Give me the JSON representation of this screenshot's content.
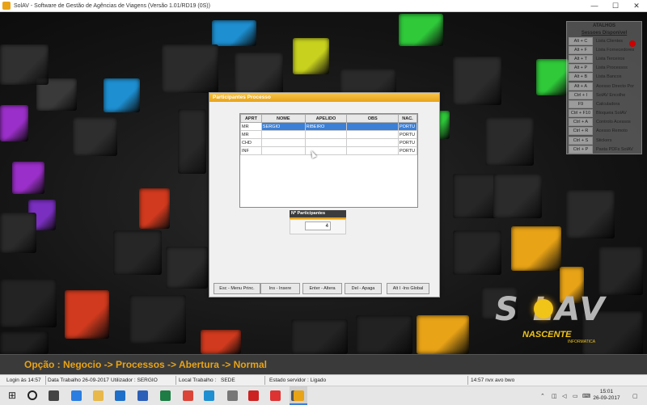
{
  "window": {
    "title": "SolAV - Software de Gestão de Agências de Viagens (Versão 1.01/RD19 (0S))",
    "controls": [
      "—",
      "☐",
      "✕"
    ]
  },
  "colors": {
    "accent": "#e8a317",
    "selection": "#3b7fd6",
    "path_text": "#e8a317"
  },
  "shortcuts": {
    "header1": "ATALHOS",
    "header2": "Sessoes Disponivel",
    "items": [
      {
        "key": "Alt + C",
        "label": "Lista Clientes"
      },
      {
        "key": "Alt + F",
        "label": "Lista Fornecedores"
      },
      {
        "key": "Alt + T",
        "label": "Lista Terceiros"
      },
      {
        "key": "Alt + P",
        "label": "Lista Processos"
      },
      {
        "key": "Alt + B",
        "label": "Lista Bancos"
      },
      {
        "key": "Alt + A",
        "label": "Acesso Directo Por"
      },
      {
        "key": "Ctrl + I",
        "label": "SolAV Encolhe"
      },
      {
        "key": "F9",
        "label": "Calculadora"
      },
      {
        "key": "Ctrl + F10",
        "label": "Bloqueia SolAV"
      },
      {
        "key": "Ctrl + A",
        "label": "Controlo Acessos"
      },
      {
        "key": "Ctrl + R",
        "label": "Acesso Remoto"
      },
      {
        "key": "Ctrl + S",
        "label": "Stickers"
      },
      {
        "key": "Ctrl + P",
        "label": "Pasta PDFs SolAV"
      }
    ]
  },
  "logo": {
    "word": "S  LAV",
    "sub": "NASCENTE",
    "sub2": "INFORMATICA"
  },
  "dialog": {
    "title": "Participantes Processo",
    "columns": [
      "APRT",
      "NOME",
      "APELIDO",
      "OBS",
      "NAC."
    ],
    "rows": [
      {
        "aprt": "MR",
        "nome": "SERGIO",
        "apelido": "RIBEIRO",
        "obs": "",
        "nac": "PORTU",
        "selected": true
      },
      {
        "aprt": "MR",
        "nome": "",
        "apelido": "",
        "obs": "",
        "nac": "PORTU",
        "selected": false
      },
      {
        "aprt": "CHD",
        "nome": "",
        "apelido": "",
        "obs": "",
        "nac": "PORTU",
        "selected": false
      },
      {
        "aprt": "INF",
        "nome": "",
        "apelido": "",
        "obs": "",
        "nac": "PORTU",
        "selected": false
      }
    ],
    "n_participantes_label": "Nº Participantes",
    "n_participantes_value": "4",
    "buttons": {
      "esc": "Esc - Menu Princ.",
      "ins": "Ins - Insere",
      "enter": "Enter - Altera",
      "del": "Del - Apaga",
      "alt_i": "Alt I -Ins Global"
    }
  },
  "path": "Opção : Negocio -> Processos -> Abertura -> Normal",
  "status": {
    "login": "Login às 14:57",
    "data_trabalho": "Data Trabalho 26-09-2017",
    "utilizador": "Utilizador : SERGIO",
    "local_trabalho": "Local Trabalho :",
    "sede": "SEDE",
    "estado": "Estado servidor : Ligado",
    "right": "14:57 nvx avo bwo"
  },
  "taskbar": {
    "time": "15:01",
    "date": "26-09-2017",
    "icons": [
      "windows-start-icon",
      "search-icon",
      "task-view-icon",
      "store-icon",
      "folder-icon",
      "outlook-icon",
      "word-icon",
      "excel-icon",
      "chrome-icon",
      "edge-icon",
      "app-icon",
      "acrobat-icon",
      "pdf-icon",
      "notepad-icon",
      "solav-icon"
    ]
  }
}
